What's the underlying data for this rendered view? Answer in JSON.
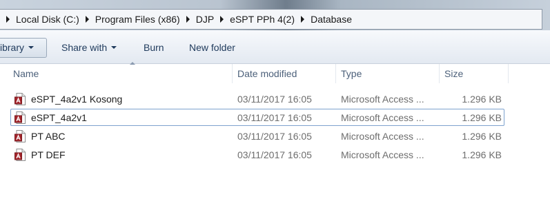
{
  "breadcrumb": [
    {
      "label": "Local Disk (C:)"
    },
    {
      "label": "Program Files (x86)"
    },
    {
      "label": "DJP"
    },
    {
      "label": "eSPT PPh 4(2)"
    },
    {
      "label": "Database"
    }
  ],
  "toolbar": {
    "library_label": "ibrary",
    "share_label": "Share with",
    "burn_label": "Burn",
    "new_folder_label": "New folder"
  },
  "columns": {
    "name": "Name",
    "date": "Date modified",
    "type": "Type",
    "size": "Size"
  },
  "files": [
    {
      "name": "eSPT_4a2v1 Kosong",
      "date": "03/11/2017 16:05",
      "type": "Microsoft Access ...",
      "size": "1.296 KB",
      "focused": false
    },
    {
      "name": "eSPT_4a2v1",
      "date": "03/11/2017 16:05",
      "type": "Microsoft Access ...",
      "size": "1.296 KB",
      "focused": true
    },
    {
      "name": "PT ABC",
      "date": "03/11/2017 16:05",
      "type": "Microsoft Access ...",
      "size": "1.296 KB",
      "focused": false
    },
    {
      "name": "PT DEF",
      "date": "03/11/2017 16:05",
      "type": "Microsoft Access ...",
      "size": "1.296 KB",
      "focused": false
    }
  ],
  "icon": {
    "file_icon": "access-database-icon",
    "accent": "#a4262c"
  }
}
